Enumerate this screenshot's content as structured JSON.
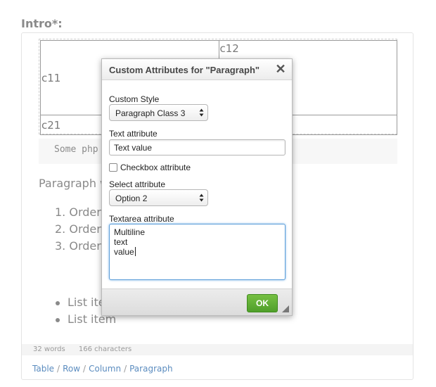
{
  "field": {
    "label": "Intro*:"
  },
  "content": {
    "table": {
      "rows": [
        {
          "cells": [
            "c11",
            "c12"
          ]
        },
        {
          "cells": [
            "c21",
            ""
          ]
        }
      ]
    },
    "code": "Some php",
    "paragraph": "Paragraph w",
    "ordered_list": [
      "1. Ordere",
      "2. Ordere",
      "3. Ordere"
    ],
    "unordered_list": [
      "List ite",
      "List item"
    ]
  },
  "status": {
    "words": "32 words",
    "characters": "166 characters"
  },
  "breadcrumb": [
    "Table",
    "Row",
    "Column",
    "Paragraph"
  ],
  "dialog": {
    "title": "Custom Attributes for \"Paragraph\"",
    "custom_style": {
      "label": "Custom Style",
      "selected": "Paragraph Class 3"
    },
    "text_attribute": {
      "label": "Text attribute",
      "value": "Text value"
    },
    "checkbox_attribute": {
      "label": "Checkbox attribute",
      "checked": false
    },
    "select_attribute": {
      "label": "Select attribute",
      "selected": "Option 2"
    },
    "textarea_attribute": {
      "label": "Textarea attribute",
      "lines": [
        "Multiline",
        "text",
        "value"
      ]
    },
    "ok_label": "OK"
  },
  "colors": {
    "accent_ok": "#5caf32",
    "focus_border": "#5b9dd9",
    "link": "#5b8cbf"
  }
}
